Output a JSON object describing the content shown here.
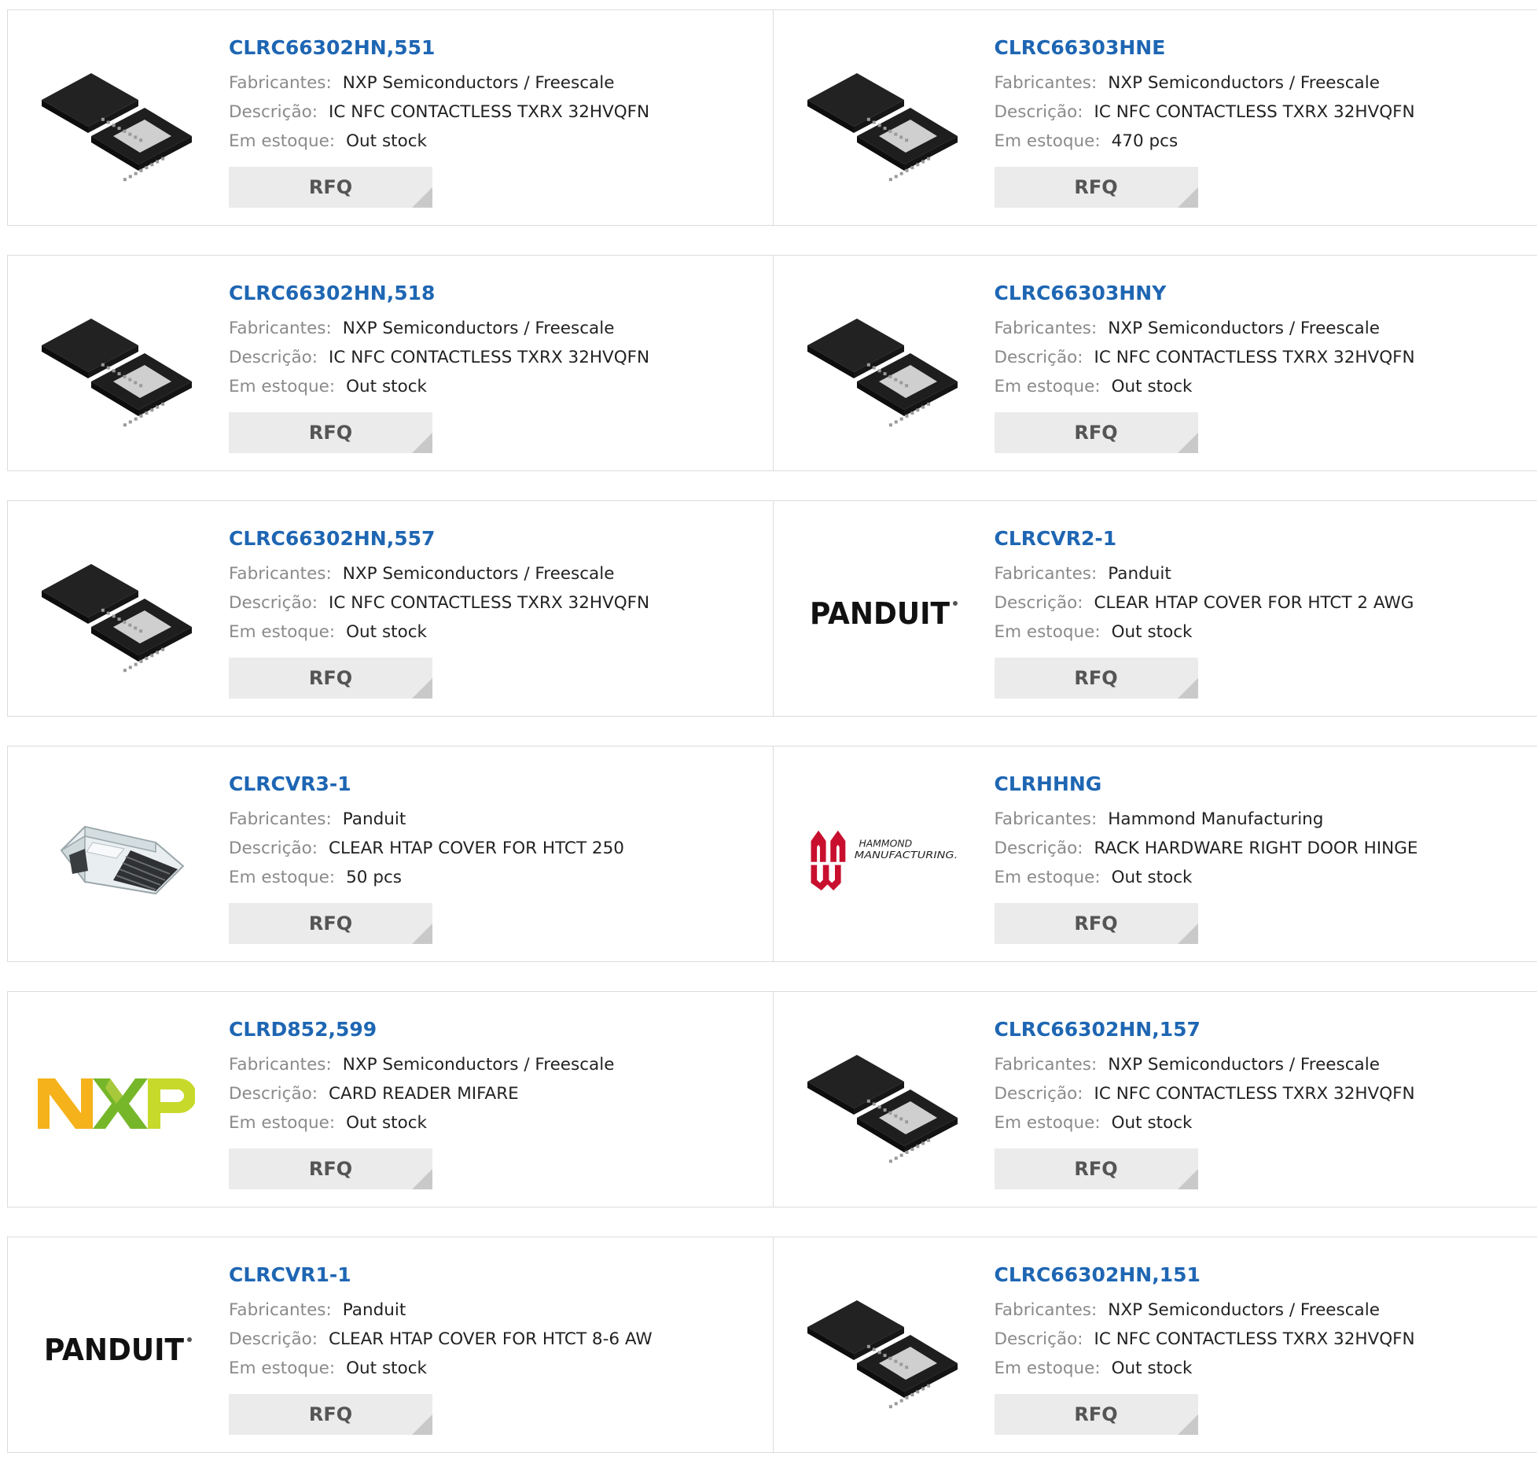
{
  "labels": {
    "manufacturer": "Fabricantes:",
    "description": "Descrição:",
    "stock": "Em estoque:"
  },
  "rfq_label": "RFQ",
  "rows": [
    [
      {
        "part": "CLRC66302HN,551",
        "manufacturer": "NXP Semiconductors / Freescale",
        "description": "IC NFC CONTACTLESS TXRX 32HVQFN",
        "stock": "Out stock",
        "image": "ic-chip-icon"
      },
      {
        "part": "CLRC66303HNE",
        "manufacturer": "NXP Semiconductors / Freescale",
        "description": "IC NFC CONTACTLESS TXRX 32HVQFN",
        "stock": "470 pcs",
        "image": "ic-chip-icon"
      }
    ],
    [
      {
        "part": "CLRC66302HN,518",
        "manufacturer": "NXP Semiconductors / Freescale",
        "description": "IC NFC CONTACTLESS TXRX 32HVQFN",
        "stock": "Out stock",
        "image": "ic-chip-icon"
      },
      {
        "part": "CLRC66303HNY",
        "manufacturer": "NXP Semiconductors / Freescale",
        "description": "IC NFC CONTACTLESS TXRX 32HVQFN",
        "stock": "Out stock",
        "image": "ic-chip-icon"
      }
    ],
    [
      {
        "part": "CLRC66302HN,557",
        "manufacturer": "NXP Semiconductors / Freescale",
        "description": "IC NFC CONTACTLESS TXRX 32HVQFN",
        "stock": "Out stock",
        "image": "ic-chip-icon"
      },
      {
        "part": "CLRCVR2-1",
        "manufacturer": "Panduit",
        "description": "CLEAR HTAP COVER FOR HTCT 2 AWG",
        "stock": "Out stock",
        "image": "panduit-logo",
        "logo_text": "PANDUIT"
      }
    ],
    [
      {
        "part": "CLRCVR3-1",
        "manufacturer": "Panduit",
        "description": "CLEAR HTAP COVER FOR HTCT 250",
        "stock": "50 pcs",
        "image": "clear-cover-icon"
      },
      {
        "part": "CLRHHNG",
        "manufacturer": "Hammond Manufacturing",
        "description": "RACK HARDWARE RIGHT DOOR HINGE",
        "stock": "Out stock",
        "image": "hammond-logo",
        "logo_text": "HAMMOND MANUFACTURING."
      }
    ],
    [
      {
        "part": "CLRD852,599",
        "manufacturer": "NXP Semiconductors / Freescale",
        "description": "CARD READER MIFARE",
        "stock": "Out stock",
        "image": "nxp-logo",
        "logo_text": "NXP"
      },
      {
        "part": "CLRC66302HN,157",
        "manufacturer": "NXP Semiconductors / Freescale",
        "description": "IC NFC CONTACTLESS TXRX 32HVQFN",
        "stock": "Out stock",
        "image": "ic-chip-icon"
      }
    ],
    [
      {
        "part": "CLRCVR1-1",
        "manufacturer": "Panduit",
        "description": "CLEAR HTAP COVER FOR HTCT 8-6 AW",
        "stock": "Out stock",
        "image": "panduit-logo",
        "logo_text": "PANDUIT"
      },
      {
        "part": "CLRC66302HN,151",
        "manufacturer": "NXP Semiconductors / Freescale",
        "description": "IC NFC CONTACTLESS TXRX 32HVQFN",
        "stock": "Out stock",
        "image": "ic-chip-icon"
      }
    ]
  ]
}
